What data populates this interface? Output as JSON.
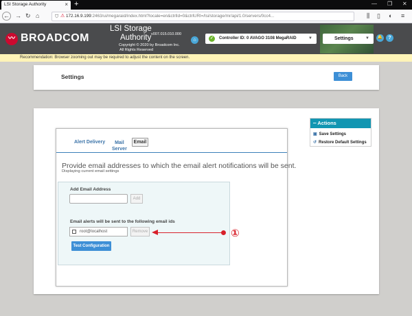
{
  "browser": {
    "tab_title": "LSI Storage Authority",
    "tab_close": "×",
    "new_tab": "+",
    "url_host": "172.16.9.199",
    "url_rest": ":2463/ui/megaraid/index.html?locale=en&ctrlId=0&ctrlURI=/lsi/storage/mr/api/1.0/servers/0cc4..."
  },
  "header": {
    "logo": "BROADCOM",
    "product_line1": "LSI Storage",
    "product_line2": "Authority",
    "version": "v007.015.010.000",
    "copyright_line1": "Copyright © 2020 by Broadcom Inc.",
    "copyright_line2": "All Rights Reserved",
    "controller_label": "Controller ID: 0 AVAGO 3108 MegaRAID",
    "settings_label": "Settings"
  },
  "recommendation": "Recommendation: Browser zooming out may be required to adjust the content on the screen.",
  "page": {
    "title": "Settings",
    "back_label": "Back"
  },
  "tabs": {
    "alert_delivery": "Alert Delivery",
    "mail_server_line1": "Mail",
    "mail_server_line2": "Server",
    "email": "Email"
  },
  "content": {
    "heading": "Provide email addresses to which the email alert notifications will be sent.",
    "subheading": "Displaying current email settings",
    "add_label": "Add Email Address",
    "add_input_value": "",
    "add_button": "Add",
    "list_label": "Email alerts will be sent to the following email ids",
    "email_entry": "root@localhost",
    "remove_button": "Remove",
    "test_button": "Test Configuration"
  },
  "annotation": {
    "number": "①"
  },
  "actions": {
    "title": "Actions",
    "items": [
      {
        "label": "Save Settings"
      },
      {
        "label": "Restore Default Settings"
      }
    ]
  }
}
